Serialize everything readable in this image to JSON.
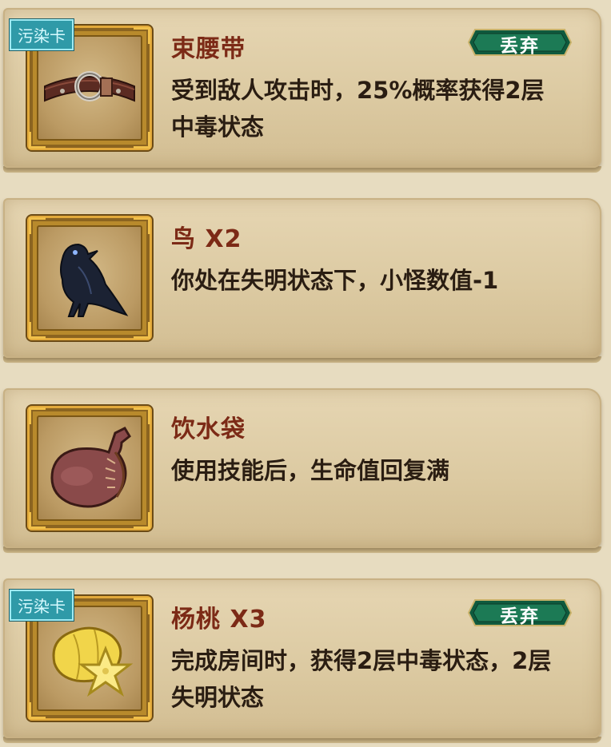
{
  "badge_label": "污染卡",
  "discard_label": "丢弃",
  "cards": [
    {
      "name": "束腰带",
      "description": "受到敌人攻击时，25%概率获得2层中毒状态",
      "icon": "belt-icon",
      "polluted": true
    },
    {
      "name": "鸟 X2",
      "description": "你处在失明状态下，小怪数值-1",
      "icon": "crow-icon",
      "polluted": false
    },
    {
      "name": "饮水袋",
      "description": "使用技能后，生命值回复满",
      "icon": "water-skin-icon",
      "polluted": false
    },
    {
      "name": "杨桃 X3",
      "description": "完成房间时，获得2层中毒状态，2层失明状态",
      "icon": "starfruit-icon",
      "polluted": true
    }
  ]
}
